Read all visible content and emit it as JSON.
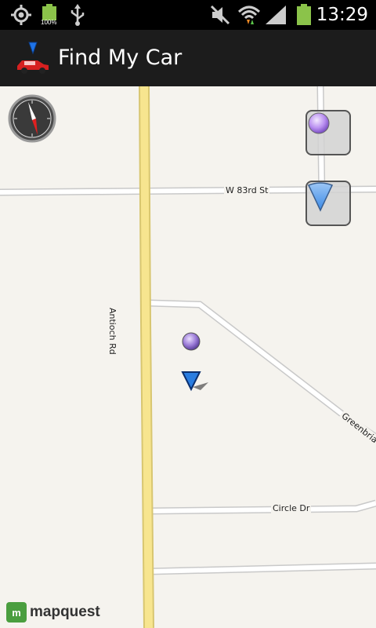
{
  "status_bar": {
    "time": "13:29",
    "battery_percent_label": "100%",
    "icons": [
      "gps-icon",
      "battery-icon",
      "usb-icon",
      "mute-icon",
      "wifi-icon",
      "signal-icon",
      "battery-full-icon"
    ]
  },
  "action_bar": {
    "title": "Find My Car",
    "icon": "car-marker-icon"
  },
  "map": {
    "roads": {
      "w83rd": "W 83rd St",
      "antioch": "Antioch Rd",
      "greenbriar": "Greenbria",
      "circle": "Circle Dr"
    },
    "attribution": "mapquest",
    "attribution_mark": "m",
    "colors": {
      "background": "#f5f3ee",
      "major_road": "#f5e28a",
      "minor_road": "#ffffff",
      "road_border": "#c9c9c9",
      "car_marker": "#2a7de0",
      "location_dot": "#9a7ad6"
    }
  },
  "controls": {
    "my_location_button": "purple-dot-icon",
    "car_location_button": "blue-triangle-icon",
    "compass": "compass-icon"
  }
}
